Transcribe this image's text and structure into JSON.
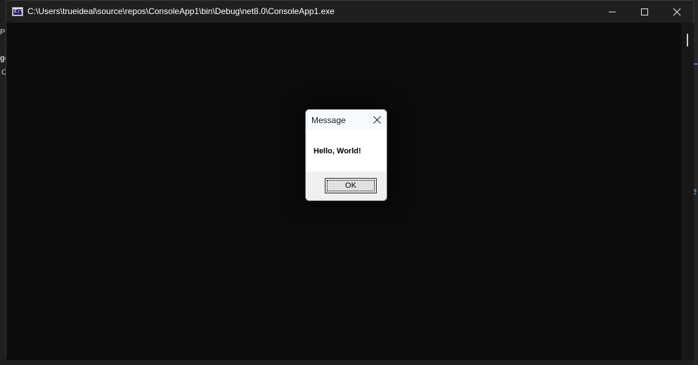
{
  "window": {
    "title": "C:\\Users\\trueideal\\source\\repos\\ConsoleApp1\\bin\\Debug\\net8.0\\ConsoleApp1.exe",
    "icon": "console-app-icon",
    "icon_glyph": "C:\\",
    "controls": {
      "minimize": "minimize-icon",
      "maximize": "maximize-icon",
      "close": "close-icon"
    },
    "console_background": "#0c0c0c"
  },
  "background_ide": {
    "left_snippets": [
      "Pr",
      "ge",
      "C"
    ],
    "right_snippet": "e"
  },
  "message_box": {
    "title": "Message",
    "message": "Hello, World!",
    "ok_label": "OK",
    "close_icon": "close-icon"
  }
}
